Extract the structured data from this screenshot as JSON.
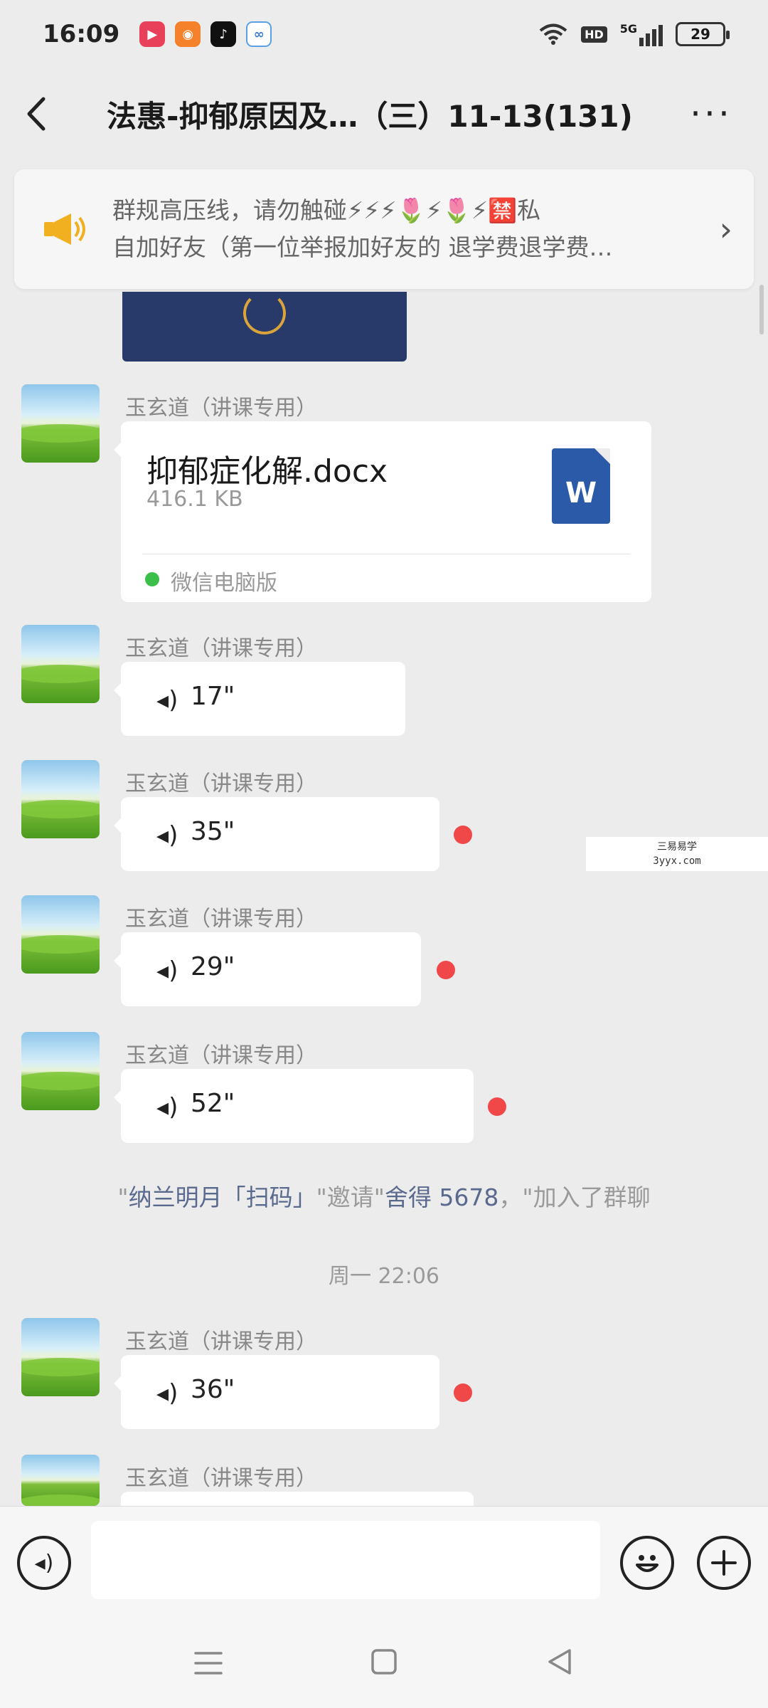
{
  "status_bar": {
    "time": "16:09",
    "network_label": "5G",
    "hd_label": "HD",
    "battery": "29"
  },
  "header": {
    "title": "法惠-抑郁原因及…（三）11-13(131)",
    "back_icon": "chevron-left-icon",
    "more_icon": "more-dots-icon"
  },
  "notice": {
    "line1": "群规高压线，请勿触碰⚡⚡⚡🌷⚡🌷⚡🈲私",
    "line2": "自加好友（第一位举报加好友的 退学费退学费…",
    "icon": "megaphone-icon"
  },
  "messages": {
    "sender_name": "玉玄道（讲课专用）",
    "file": {
      "name": "抑郁症化解.docx",
      "size": "416.1 KB",
      "type_letter": "W",
      "source": "微信电脑版"
    },
    "voice1": {
      "duration": "17\""
    },
    "voice2": {
      "duration": "35\""
    },
    "voice3": {
      "duration": "29\""
    },
    "voice4": {
      "duration": "52\""
    },
    "voice5": {
      "duration": "36\""
    }
  },
  "system": {
    "join_inviter_prefix": "\"",
    "join_name": "纳兰明月「扫码」",
    "join_mid": "\"邀请\"",
    "join_invitee": "舍得 5678",
    "join_suffix": "，\"加入了群聊",
    "time_separator": "周一 22:06"
  },
  "watermark": {
    "line1": "三易易学",
    "line2": "3yyx.com"
  },
  "input_bar": {
    "voice_icon": "voice-mode-icon",
    "emoji_icon": "emoji-icon",
    "plus_icon": "plus-icon",
    "input_value": ""
  },
  "colors": {
    "background": "#ececec",
    "bubble": "#ffffff",
    "unread": "#f04848",
    "word_blue": "#2b5aa8"
  }
}
